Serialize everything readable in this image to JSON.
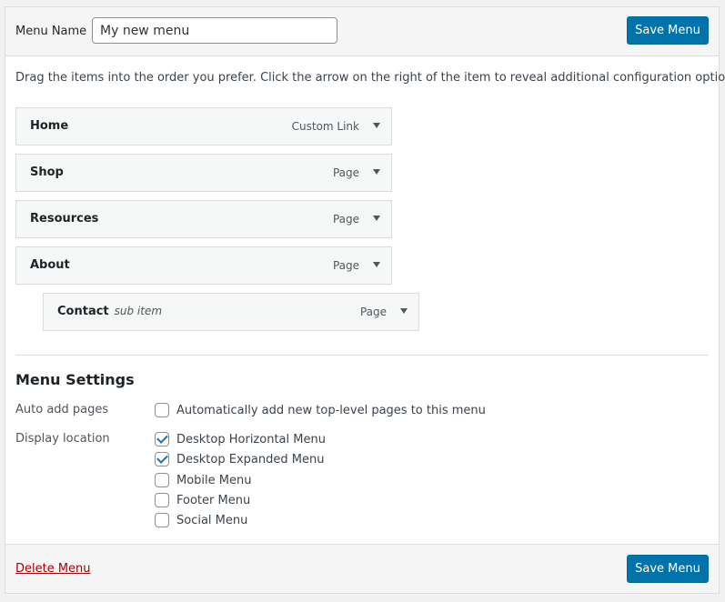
{
  "header": {
    "menu_name_label": "Menu Name",
    "menu_name_value": "My new menu",
    "save_label": "Save Menu"
  },
  "instructions": "Drag the items into the order you prefer. Click the arrow on the right of the item to reveal additional configuration options.",
  "menu_items": [
    {
      "title": "Home",
      "subtitle": "",
      "type": "Custom Link",
      "depth": 0
    },
    {
      "title": "Shop",
      "subtitle": "",
      "type": "Page",
      "depth": 0
    },
    {
      "title": "Resources",
      "subtitle": "",
      "type": "Page",
      "depth": 0
    },
    {
      "title": "About",
      "subtitle": "",
      "type": "Page",
      "depth": 0
    },
    {
      "title": "Contact",
      "subtitle": "sub item",
      "type": "Page",
      "depth": 1
    }
  ],
  "settings": {
    "title": "Menu Settings",
    "auto_add": {
      "label": "Auto add pages",
      "option": {
        "label": "Automatically add new top-level pages to this menu",
        "checked": false
      }
    },
    "display_location": {
      "label": "Display location",
      "options": [
        {
          "label": "Desktop Horizontal Menu",
          "checked": true
        },
        {
          "label": "Desktop Expanded Menu",
          "checked": true
        },
        {
          "label": "Mobile Menu",
          "checked": false
        },
        {
          "label": "Footer Menu",
          "checked": false
        },
        {
          "label": "Social Menu",
          "checked": false
        }
      ]
    }
  },
  "footer": {
    "delete_label": "Delete Menu",
    "save_label": "Save Menu"
  },
  "colors": {
    "primary_button": "#0073aa",
    "delete_link": "#aa0000",
    "checkmark": "#2271b1"
  },
  "icons": {
    "item_toggle": "arrow-down-icon",
    "checkbox_checked": "checkmark-icon"
  }
}
